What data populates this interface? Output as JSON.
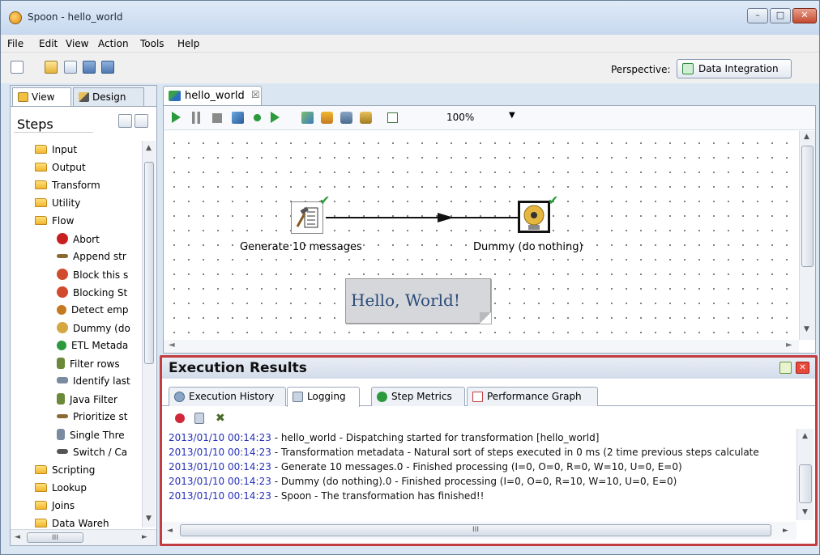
{
  "window": {
    "title": "Spoon - hello_world",
    "min_label": "–",
    "max_label": "□",
    "close_label": "✕"
  },
  "menu": {
    "items": [
      {
        "label": "File"
      },
      {
        "label": "Edit"
      },
      {
        "label": "View"
      },
      {
        "label": "Action"
      },
      {
        "label": "Tools"
      },
      {
        "label": "Help"
      }
    ]
  },
  "toolbar": {
    "perspective_label": "Perspective:",
    "perspective_value": "Data Integration"
  },
  "left_panel": {
    "tabs": [
      {
        "label": "View",
        "icon": "view-icon"
      },
      {
        "label": "Design",
        "icon": "design-icon"
      }
    ],
    "steps_label": "Steps",
    "tree": [
      {
        "label": "Input",
        "type": "folder"
      },
      {
        "label": "Output",
        "type": "folder"
      },
      {
        "label": "Transform",
        "type": "folder"
      },
      {
        "label": "Utility",
        "type": "folder"
      },
      {
        "label": "Flow",
        "type": "folder"
      },
      {
        "label": "Abort",
        "type": "step",
        "icon": "abort-icon",
        "color": "#c8201e"
      },
      {
        "label": "Append str",
        "type": "step",
        "icon": "append-streams-icon",
        "color": "#8a6a30"
      },
      {
        "label": "Block this s",
        "type": "step",
        "icon": "block-icon",
        "color": "#d24a2e"
      },
      {
        "label": "Blocking St",
        "type": "step",
        "icon": "blocking-step-icon",
        "color": "#d24a2e"
      },
      {
        "label": "Detect emp",
        "type": "step",
        "icon": "detect-empty-stream-icon",
        "color": "#c47a20"
      },
      {
        "label": "Dummy (do",
        "type": "step",
        "icon": "dummy-icon",
        "color": "#d6a640"
      },
      {
        "label": "ETL Metada",
        "type": "step",
        "icon": "etl-metadata-icon",
        "color": "#2c9a3c"
      },
      {
        "label": "Filter rows",
        "type": "step",
        "icon": "filter-rows-icon",
        "color": "#6a8a3a"
      },
      {
        "label": "Identify last",
        "type": "step",
        "icon": "identify-last-row-icon",
        "color": "#7a8aa0"
      },
      {
        "label": "Java Filter",
        "type": "step",
        "icon": "java-filter-icon",
        "color": "#6a8a3a"
      },
      {
        "label": "Prioritize st",
        "type": "step",
        "icon": "prioritize-streams-icon",
        "color": "#8a6a30"
      },
      {
        "label": "Single Thre",
        "type": "step",
        "icon": "single-threader-icon",
        "color": "#7a8aa0"
      },
      {
        "label": "Switch / Ca",
        "type": "step",
        "icon": "switch-case-icon",
        "color": "#555555"
      },
      {
        "label": "Scripting",
        "type": "folder"
      },
      {
        "label": "Lookup",
        "type": "folder"
      },
      {
        "label": "Joins",
        "type": "folder"
      },
      {
        "label": "Data Wareh",
        "type": "folder"
      }
    ],
    "hscroll_grip": "III"
  },
  "editor": {
    "tab_label": "hello_world",
    "tab_close": "☒",
    "zoom": "100%",
    "steps": {
      "generate_label": "Generate 10 messages",
      "dummy_label": "Dummy (do nothing)"
    },
    "note_text": "Hello, World!"
  },
  "execution": {
    "title": "Execution Results",
    "tabs": [
      {
        "label": "Execution History",
        "icon": "execution-history-icon"
      },
      {
        "label": "Logging",
        "icon": "logging-icon"
      },
      {
        "label": "Step Metrics",
        "icon": "step-metrics-icon"
      },
      {
        "label": "Performance Graph",
        "icon": "performance-graph-icon"
      }
    ],
    "log_lines": [
      {
        "ts": "2013/01/10 00:14:23",
        "msg": " - hello_world - Dispatching started for transformation [hello_world]"
      },
      {
        "ts": "2013/01/10 00:14:23",
        "msg": " - Transformation metadata - Natural sort of steps executed in 0 ms (2 time previous steps calculate"
      },
      {
        "ts": "2013/01/10 00:14:23",
        "msg": " - Generate 10 messages.0 - Finished processing (I=0, O=0, R=0, W=10, U=0, E=0)"
      },
      {
        "ts": "2013/01/10 00:14:23",
        "msg": " - Dummy (do nothing).0 - Finished processing (I=0, O=0, R=10, W=10, U=0, E=0)"
      },
      {
        "ts": "2013/01/10 00:14:23",
        "msg": " - Spoon - The transformation has finished!!"
      }
    ],
    "hscroll_grip": "III"
  },
  "colors": {
    "exec_border": "#c33c40",
    "log_timestamp": "#2630b8",
    "check_green": "#2c9a3c"
  }
}
